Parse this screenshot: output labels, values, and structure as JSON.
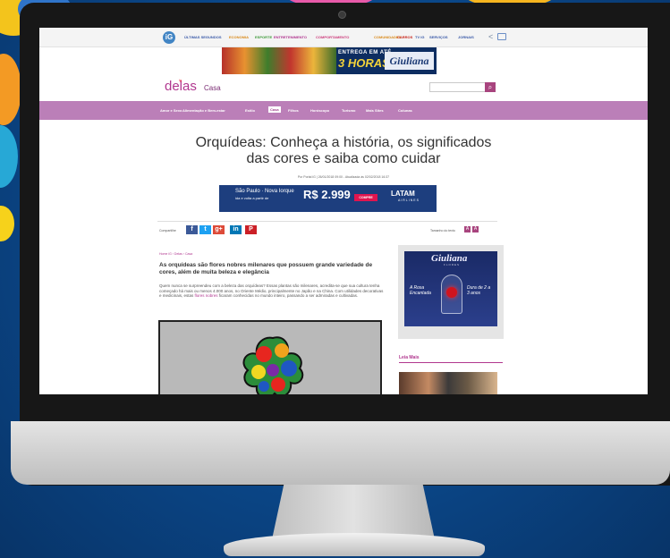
{
  "topnav": {
    "items": [
      {
        "label": "ÚLTIMAS SEGUNDOS",
        "color": "#3a5aa8"
      },
      {
        "label": "ECONOMIA",
        "color": "#d98a1b"
      },
      {
        "label": "ESPORTE",
        "color": "#3e9a3a"
      },
      {
        "label": "ENTRETENIMENTO",
        "color": "#b1378f"
      },
      {
        "label": "COMPORTAMENTO",
        "color": "#cc3a7a"
      },
      {
        "label": "COMUNIDADES",
        "color": "#d98a1b"
      },
      {
        "label": "CARROS",
        "color": "#c8281e"
      },
      {
        "label": "TV IG",
        "color": "#3a5aa8"
      },
      {
        "label": "SERVIÇOS",
        "color": "#3a5aa8"
      },
      {
        "label": "JORNAIS",
        "color": "#3a5aa8"
      }
    ]
  },
  "ad_top": {
    "entrega": "ENTREGA EM ATÉ",
    "horas": "3 HORAS",
    "brand": "Giuliana",
    "brand_sub": "FLORES"
  },
  "header": {
    "logo": "delas",
    "logo_prefix": "ig",
    "section": "Casa",
    "search_icon": "⌕"
  },
  "categories": [
    {
      "label": "Amor e Sexo",
      "active": false
    },
    {
      "label": "Alimentação e Bem-estar",
      "active": false
    },
    {
      "label": "Estilo",
      "active": false
    },
    {
      "label": "Casa",
      "active": true
    },
    {
      "label": "Filhos",
      "active": false
    },
    {
      "label": "Horóscopo",
      "active": false
    },
    {
      "label": "Turismo",
      "active": false
    },
    {
      "label": "Mais Sites",
      "active": false
    },
    {
      "label": "Colunas",
      "active": false
    }
  ],
  "article": {
    "title_line1": "Orquídeas: Conheça a história, os significados",
    "title_line2": "das cores e saiba como cuidar",
    "byline": "Por Portal iG | 26/01/2018 09:00 - Atualizada às 02/02/2018 16:37",
    "breadcrumb": "Home iG › Delas › Casa",
    "lead": "As orquídeas são flores nobres milenares que possuem grande variedade de cores, além de muita beleza e elegância",
    "body_text": "Quem nunca se surpreendeu com a beleza das orquídeas? Essas plantas são milenares, acredita-se que sua cultura tenha começado há mais ou menos 4.000 anos, no Oriente Médio, principalmente no Japão e na China. Com utilidades decorativas e medicinais, estas ",
    "body_link": "flores nobres",
    "body_end": " ficaram conhecidas no mundo inteiro, passando a ser admiradas e cultivadas."
  },
  "ad_mid": {
    "line1": "São Paulo · Nova Iorque",
    "line2": "ida e volta a partir de",
    "price": "R$ 2.999",
    "cta": "COMPRE",
    "brand": "LATAM",
    "brand_sub": "AIRLINES"
  },
  "share": {
    "label": "Compartilhe",
    "buttons": [
      {
        "icon": "facebook-icon",
        "glyph": "f",
        "color": "#3b5998"
      },
      {
        "icon": "twitter-icon",
        "glyph": "t",
        "color": "#1da1f2"
      },
      {
        "icon": "googleplus-icon",
        "glyph": "g+",
        "color": "#dd4b39"
      },
      {
        "icon": "linkedin-icon",
        "glyph": "in",
        "color": "#0077b5"
      },
      {
        "icon": "pinterest-icon",
        "glyph": "P",
        "color": "#cb2027"
      }
    ],
    "fontsize_label": "Tamanho do texto",
    "fontsize_minus": "A",
    "fontsize_plus": "A"
  },
  "side_ad": {
    "brand": "Giuliana",
    "brand_sub": "FLORES",
    "left_text": "A Rosa Encantada",
    "right_text": "Dura de 2 a 3 anos"
  },
  "sidebar": {
    "leia_mais": "Leia Mais"
  }
}
